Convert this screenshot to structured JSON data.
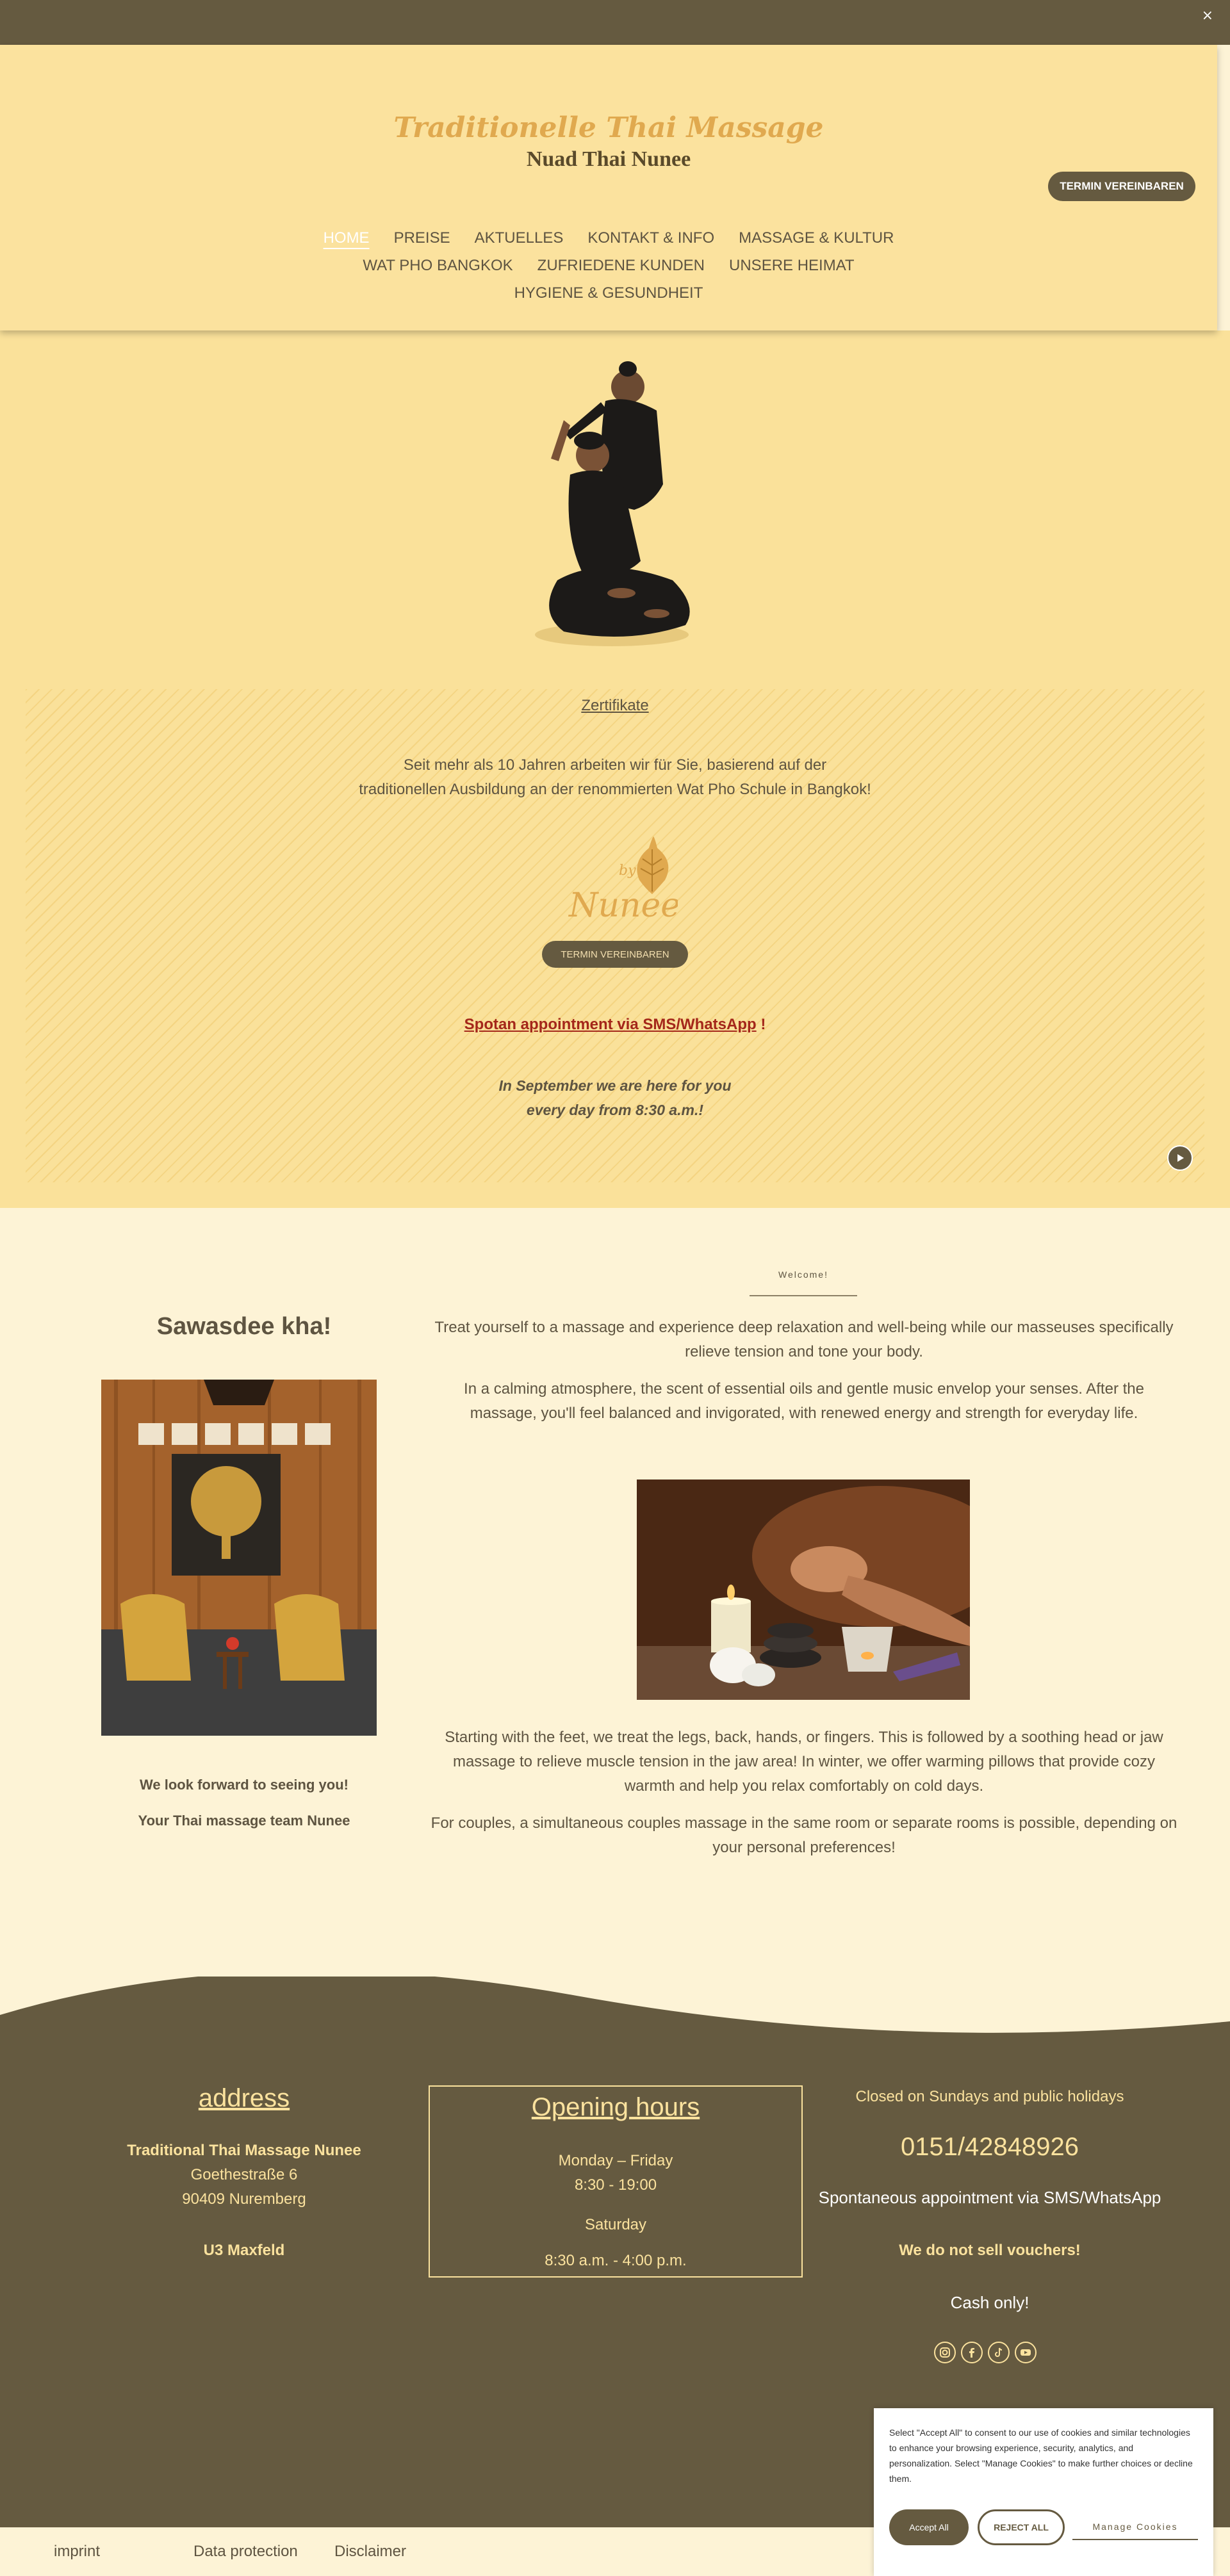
{
  "topbar": {
    "close_label": "×"
  },
  "header": {
    "title": "Traditionelle Thai Massage",
    "subtitle": "Nuad Thai Nunee",
    "cta_label": "TERMIN VEREINBAREN",
    "nav": [
      [
        "HOME",
        "PREISE",
        "AKTUELLES",
        "KONTAKT & INFO",
        "MASSAGE & KULTUR"
      ],
      [
        "WAT PHO BANGKOK",
        "ZUFRIEDENE KUNDEN",
        "UNSERE HEIMAT"
      ],
      [
        "HYGIENE & GESUNDHEIT"
      ]
    ],
    "active_nav": "HOME"
  },
  "hero": {
    "cert_link": "Zertifikate",
    "text": "Seit mehr als 10 Jahren arbeiten wir für Sie, basierend auf der traditionellen Ausbildung an der renommierten Wat Pho Schule in Bangkok!",
    "logo_text": "by Nunee",
    "cta_label": "TERMIN VEREINBAREN",
    "sms_link": "Spotan appointment via SMS/WhatsApp",
    "sms_suffix": " !",
    "september_line1": "In September we are here for you",
    "september_line2": "every day from 8:30 a.m.!"
  },
  "content": {
    "welcome_label": "Welcome!",
    "heading": "Sawasdee kha!",
    "left_note_1": "We look forward to seeing you!",
    "left_note_2": "Your Thai massage team Nunee",
    "para1": "Treat yourself to a massage and experience deep relaxation and well-being while our masseuses specifically relieve tension and tone your body.",
    "para2": "In a calming atmosphere, the scent of essential oils and gentle music envelop your senses. After the massage, you'll feel balanced and invigorated, with renewed energy and strength for everyday life.",
    "para3": "Starting with the feet, we treat the legs, back, hands, or fingers. This is followed by a soothing head or jaw massage to relieve muscle tension in the jaw area! In winter, we offer warming pillows that provide cozy warmth and help you relax comfortably on cold days.",
    "para4": "For couples, a simultaneous couples massage in the same room or separate rooms is possible, depending on your personal preferences!"
  },
  "footer": {
    "address_title": "address",
    "address_name": "Traditional Thai Massage Nunee",
    "address_street": "Goethestraße 6",
    "address_city": "90409 Nuremberg",
    "address_transit": "U3 Maxfeld",
    "hours_title": "Opening hours",
    "hours_weekdays": "Monday – Friday",
    "hours_weekdays_time": "8:30 - 19:00",
    "hours_saturday": "Saturday",
    "hours_saturday_time": "8:30 a.m. - 4:00 p.m.",
    "closed_note": "Closed on Sundays and public holidays",
    "phone": "0151/42848926",
    "sms_note": "Spontaneous appointment via SMS/WhatsApp",
    "vouchers_note": "We do not sell vouchers!",
    "cash_note": "Cash only!",
    "social_icons": [
      "instagram-icon",
      "facebook-icon",
      "tiktok-icon",
      "youtube-icon"
    ]
  },
  "bottom_links": {
    "imprint": "imprint",
    "data_protection": "Data protection",
    "disclaimer": "Disclaimer"
  },
  "cookie": {
    "text": "Select \"Accept All\" to consent to our use of cookies and similar technologies to enhance your browsing experience, security, analytics, and personalization. Select \"Manage Cookies\" to make further choices or decline them.",
    "accept_label": "Accept All",
    "reject_label": "REJECT ALL",
    "manage_label": "Manage Cookies"
  },
  "colors": {
    "brand_dark": "#655a40",
    "header_bg": "#fbe29e",
    "accent_gold": "#e0a94f",
    "link_red": "#a4271a"
  }
}
